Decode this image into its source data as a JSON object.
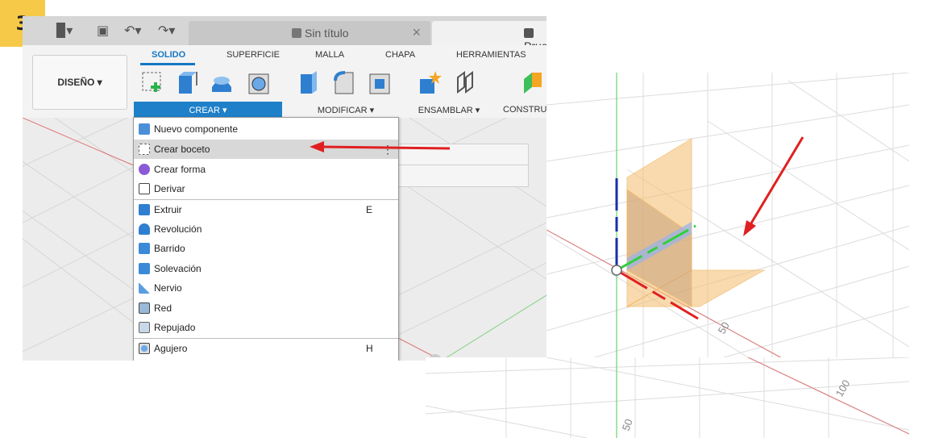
{
  "step": "3",
  "titlebar": {
    "tab_active": "Sin título",
    "tab_close": "×",
    "tab_other": "Prue"
  },
  "ribbon": {
    "workspace_button": "DISEÑO ▾",
    "tabs": [
      "SOLIDO",
      "SUPERFICIE",
      "MALLA",
      "CHAPA",
      "HERRAMIENTAS"
    ],
    "groups": [
      "CREAR ▾",
      "MODIFICAR ▾",
      "ENSAMBLAR ▾",
      "CONSTRU"
    ]
  },
  "menu": {
    "items": [
      {
        "label": "Nuevo componente",
        "shortcut": ""
      },
      {
        "label": "Crear boceto",
        "shortcut": ""
      },
      {
        "label": "Crear forma",
        "shortcut": ""
      },
      {
        "label": "Derivar",
        "shortcut": ""
      },
      {
        "label": "Extruir",
        "shortcut": "E"
      },
      {
        "label": "Revolución",
        "shortcut": ""
      },
      {
        "label": "Barrido",
        "shortcut": ""
      },
      {
        "label": "Solevación",
        "shortcut": ""
      },
      {
        "label": "Nervio",
        "shortcut": ""
      },
      {
        "label": "Red",
        "shortcut": ""
      },
      {
        "label": "Repujado",
        "shortcut": ""
      },
      {
        "label": "Agujero",
        "shortcut": "H"
      }
    ],
    "more": "⋮",
    "highlighted_index": 1
  },
  "viewport_labels": {
    "grid_label_a": "50",
    "grid_label_b": "100",
    "grid_label_c": "50"
  },
  "colors": {
    "accent_blue": "#1e80c9",
    "badge": "#f7c948",
    "arrow_red": "#e02020",
    "plane_orange": "#f5c27a"
  }
}
